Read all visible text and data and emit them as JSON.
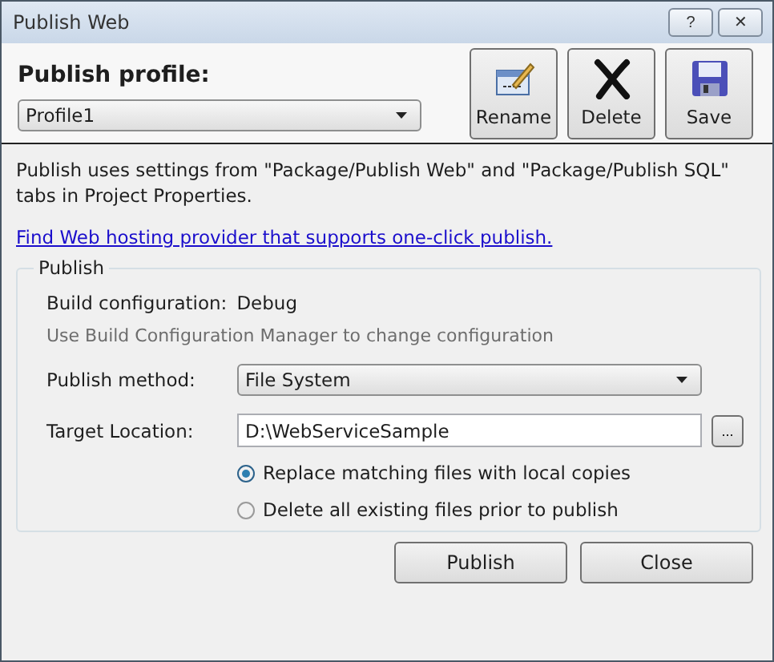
{
  "window": {
    "title": "Publish Web",
    "controls": [
      "?",
      "✕"
    ]
  },
  "profile": {
    "label": "Publish profile:",
    "value": "Profile1"
  },
  "toolbar": [
    {
      "kind": "rename",
      "label": "Rename"
    },
    {
      "kind": "delete",
      "label": "Delete"
    },
    {
      "kind": "save",
      "label": "Save"
    }
  ],
  "description": "Publish uses settings from \"Package/Publish Web\" and \"Package/Publish SQL\" tabs in Project Properties.",
  "link": "Find Web hosting provider that supports one-click publish.",
  "group": {
    "legend": "Publish",
    "build_label": "Build configuration:",
    "build_value": "Debug",
    "note": "Use Build Configuration Manager to change configuration",
    "method_label": "Publish method:",
    "method_value": "File System",
    "target_label": "Target Location:",
    "target_value": "D:\\WebServiceSample",
    "browse": "...",
    "options": [
      {
        "label": "Replace matching files with local copies",
        "selected": true
      },
      {
        "label": "Delete all existing files prior to publish",
        "selected": false
      }
    ]
  },
  "buttons": [
    "Publish",
    "Close"
  ]
}
